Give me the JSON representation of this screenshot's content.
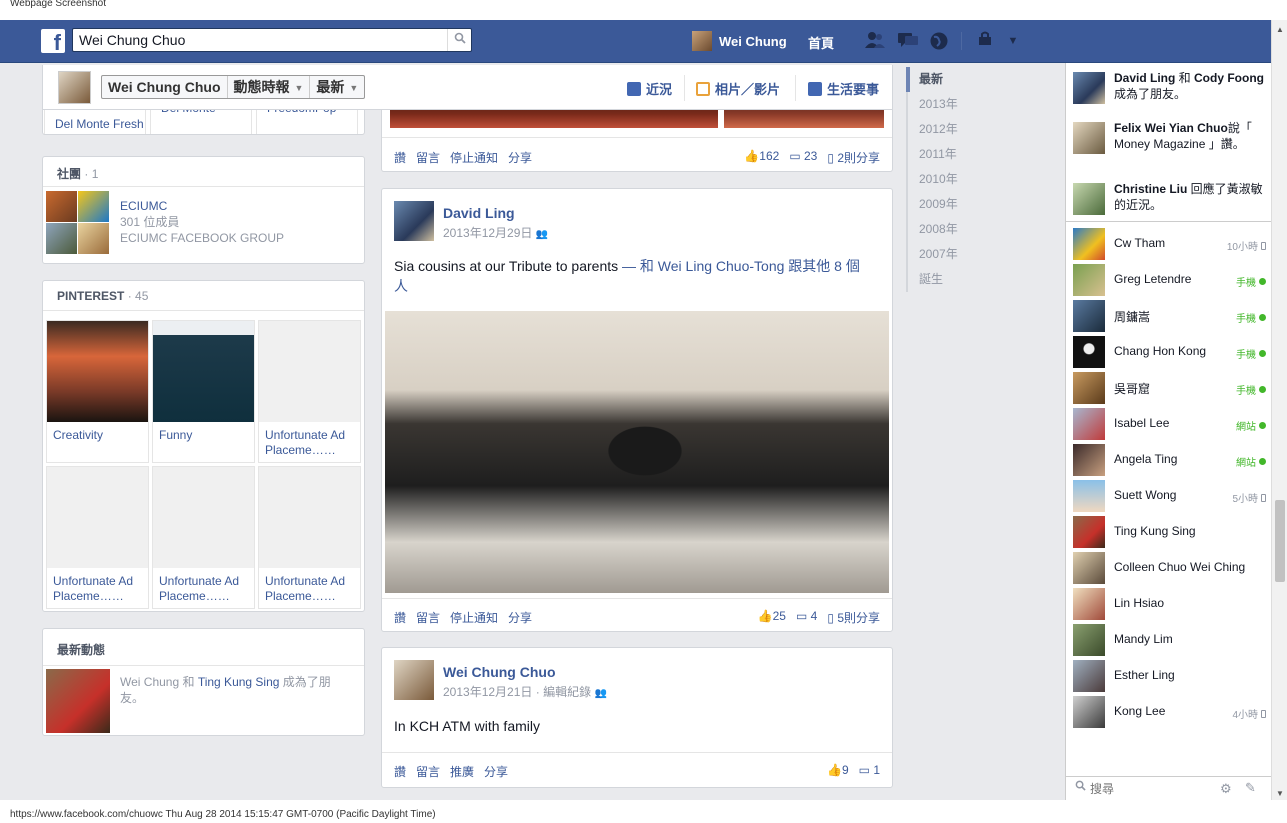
{
  "capture_title": "Webpage Screenshot",
  "topbar": {
    "search_value": "Wei Chung Chuo",
    "user_name": "Wei Chung",
    "home_label": "首頁"
  },
  "timeline_header": {
    "name": "Wei Chung Chuo",
    "filter1": "動態時報",
    "filter2": "最新",
    "tabs": [
      {
        "label": "近況",
        "icon": "pencil-icon"
      },
      {
        "label": "相片／影片",
        "icon": "photo-icon"
      },
      {
        "label": "生活要事",
        "icon": "flag-icon"
      }
    ]
  },
  "left": {
    "partial_labels": [
      "Del Monte Fresh",
      "Del Monte",
      "FreedomPop"
    ],
    "groups": {
      "title": "社團",
      "count": "· 1",
      "name": "ECIUMC",
      "members": "301 位成員",
      "desc": "ECIUMC FACEBOOK GROUP"
    },
    "pinterest": {
      "title": "PINTEREST",
      "count": "· 45",
      "boards": [
        "Creativity",
        "Funny",
        "Unfortunate Ad Placeme……",
        "Unfortunate Ad Placeme……",
        "Unfortunate Ad Placeme……",
        "Unfortunate Ad Placeme……"
      ]
    },
    "recent": {
      "title": "最新動態",
      "actor": "Wei Chung",
      "conj": " 和 ",
      "friend": "Ting Kung Sing",
      "tail": " 成為了朋友。"
    }
  },
  "posts": [
    {
      "actions": [
        "讚",
        "留言",
        "停止通知",
        "分享"
      ],
      "likes": "162",
      "comments": "23",
      "shares": "2則分享"
    },
    {
      "author": "David Ling",
      "date": "2013年12月29日",
      "text_main": "Sia cousins at our Tribute to parents",
      "text_with": " — 和 ",
      "text_tag": "Wei Ling Chuo-Tong",
      "text_others": " 跟其他 8 個人",
      "actions": [
        "讚",
        "留言",
        "停止通知",
        "分享"
      ],
      "likes": "25",
      "comments": "4",
      "shares": "5則分享"
    },
    {
      "author": "Wei Chung Chuo",
      "date": "2013年12月21日",
      "edit": "· 編輯紀錄",
      "text": "In KCH ATM with family",
      "actions": [
        "讚",
        "留言",
        "推廣",
        "分享"
      ],
      "likes": "9",
      "comments": "1"
    }
  ],
  "year_nav": [
    "最新",
    "2013年",
    "2012年",
    "2011年",
    "2010年",
    "2009年",
    "2008年",
    "2007年",
    "誕生"
  ],
  "ticker": [
    {
      "name": "David Ling",
      "mid": " 和 ",
      "name2": "Cody Foong",
      "tail": " 成為了朋友。"
    },
    {
      "name": "Felix Wei Yian Chuo",
      "tail": "說「 Money Magazine 」讚。"
    },
    {
      "name": "Christine Liu",
      "tail": " 回應了黃淑敏的近況。"
    }
  ],
  "chat": [
    {
      "name": "Cw Tham",
      "status": "10小時",
      "type": "time"
    },
    {
      "name": "Greg Letendre",
      "status": "手機",
      "type": "online"
    },
    {
      "name": "周鏞嵩",
      "status": "手機",
      "type": "online"
    },
    {
      "name": "Chang Hon Kong",
      "status": "手機",
      "type": "online"
    },
    {
      "name": "吳哥窟",
      "status": "手機",
      "type": "online"
    },
    {
      "name": "Isabel Lee",
      "status": "網站",
      "type": "online"
    },
    {
      "name": "Angela Ting",
      "status": "網站",
      "type": "online"
    },
    {
      "name": "Suett Wong",
      "status": "5小時",
      "type": "time"
    },
    {
      "name": "Ting Kung Sing",
      "status": "",
      "type": "none"
    },
    {
      "name": "Colleen Chuo Wei Ching",
      "status": "",
      "type": "none"
    },
    {
      "name": "Lin Hsiao",
      "status": "",
      "type": "none"
    },
    {
      "name": "Mandy Lim",
      "status": "",
      "type": "none"
    },
    {
      "name": "Esther Ling",
      "status": "",
      "type": "none"
    },
    {
      "name": "Kong Lee",
      "status": "4小時",
      "type": "time"
    }
  ],
  "sidebar_search_placeholder": "搜尋",
  "statusbar": "https://www.facebook.com/chuowc Thu Aug 28 2014 15:15:47 GMT-0700 (Pacific Daylight Time)",
  "colors": {
    "brand": "#3b5998",
    "online": "#42b72a",
    "page_bg": "#e9eaed"
  }
}
